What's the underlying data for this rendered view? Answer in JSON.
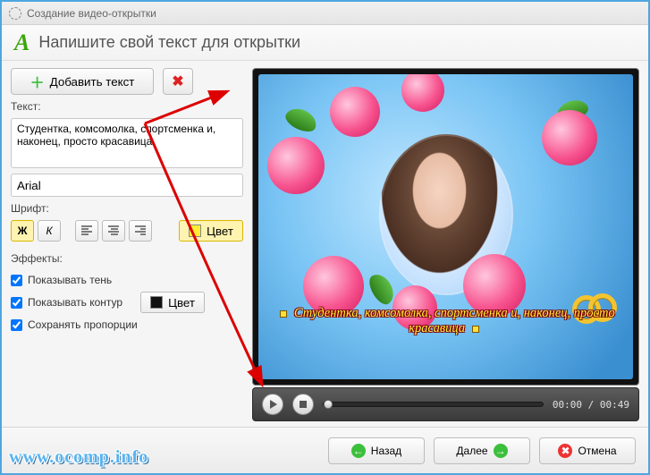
{
  "window": {
    "title": "Создание видео-открытки"
  },
  "header": {
    "icon_letter": "A",
    "title": "Напишите свой текст для открытки"
  },
  "left": {
    "add_text": "Добавить текст",
    "text_label": "Текст:",
    "text_value": "Студентка, комсомолка, спортсменка и, наконец, просто красавица",
    "font_value": "Arial",
    "font_label": "Шрифт:",
    "bold": "Ж",
    "italic": "К",
    "color_btn": "Цвет",
    "effects_label": "Эффекты:",
    "chk_shadow": "Показывать тень",
    "chk_contour": "Показывать контур",
    "contour_color_btn": "Цвет",
    "chk_prop": "Сохранять пропорции"
  },
  "preview": {
    "overlay_text": "Студентка, комсомолка, спортсменка и, наконец, просто красавица"
  },
  "player": {
    "time_current": "00:00",
    "time_total": "00:49"
  },
  "footer": {
    "back": "Назад",
    "next": "Далее",
    "cancel": "Отмена"
  },
  "watermark": "www.ocomp.info"
}
